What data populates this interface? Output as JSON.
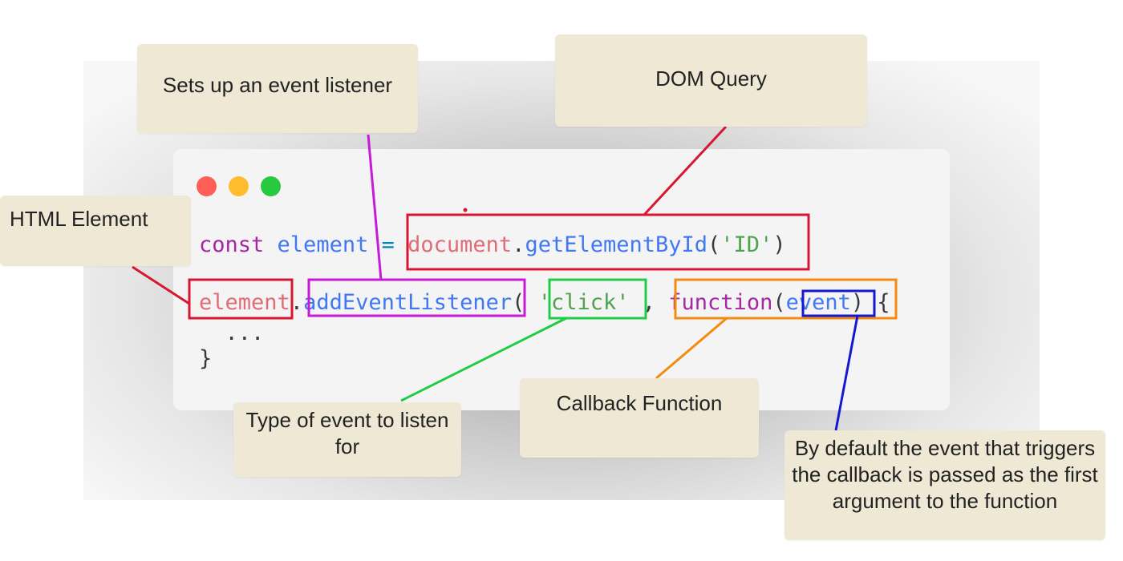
{
  "window": {
    "controls": [
      {
        "name": "close",
        "color": "#ff5f56"
      },
      {
        "name": "minimize",
        "color": "#ffbd2e"
      },
      {
        "name": "maximize",
        "color": "#27c93f"
      }
    ]
  },
  "code": {
    "line1": {
      "keyword": "const",
      "variable": "element",
      "operator": "=",
      "object": "document",
      "dot": ".",
      "method": "getElementById",
      "open_paren": "(",
      "argument": "'ID'",
      "close_paren": ")"
    },
    "line2": {
      "object": "element",
      "dot": ".",
      "method": "addEventListener",
      "open_paren": "(",
      "event_type": "'click'",
      "comma": ",",
      "function_keyword": "function",
      "fn_open_paren": "(",
      "parameter": "event",
      "fn_close_paren": ")",
      "brace": "{"
    },
    "line3": "...",
    "line4": "}"
  },
  "callouts": {
    "listener": "Sets up an event listener",
    "dom_query": "DOM Query",
    "html_element": "HTML Element",
    "event_type": "Type of event to listen for",
    "callback": "Callback Function",
    "default_event": "By default the event that triggers the callback is passed as the first argument to the function"
  },
  "colors": {
    "dom_query": "#d7172f",
    "html_element": "#d7172f",
    "listener": "#c71ad6",
    "event_type": "#1fcc46",
    "callback": "#f28c0f",
    "parameter": "#1418d0"
  }
}
